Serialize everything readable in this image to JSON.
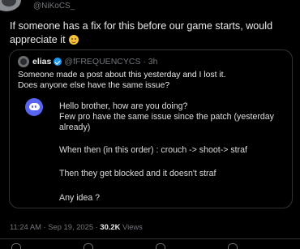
{
  "author": {
    "handle": "@NiKoCS_"
  },
  "tweet": {
    "text": "If someone has a fix for this before our game starts, would appreciate it",
    "emoji": "slightly-smiling-face"
  },
  "quote": {
    "name": "elias",
    "handle": "@fFREQUENCYCS",
    "age": "3h",
    "text_line1": "Someone made a post about this yesterday and I lost it.",
    "text_line2": "Does anyone else have the same issue?",
    "embed": {
      "icon": "discord-icon",
      "lines": [
        "Hello brother, how are you doing?",
        "Few pro have the same issue since the patch (yesterday already)",
        "When then (in this order) : crouch -> shoot-> straf",
        "Then they get blocked and it doesn't straf",
        "Any idea ?"
      ]
    }
  },
  "timestamp": {
    "time": "11:24 AM",
    "date": "Sep 19, 2025",
    "views_count": "30.2K",
    "views_label": "Views"
  },
  "colors": {
    "background": "#000000",
    "text": "#e7e9ea",
    "muted": "#71767b",
    "verified": "#1d9bf0",
    "discord": "#5865f2"
  }
}
